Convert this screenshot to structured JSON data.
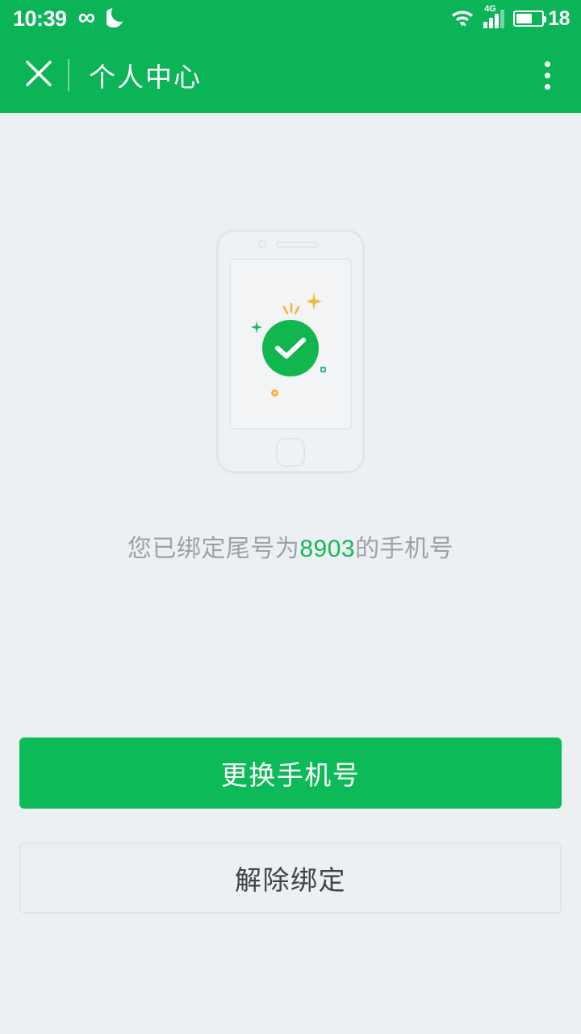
{
  "status_bar": {
    "time": "10:39",
    "infinity_icon": "infinity-icon",
    "moon_icon": "moon-icon",
    "wifi_icon": "wifi-icon",
    "network_type": "4G",
    "signal_icon": "signal-icon",
    "battery_icon": "battery-icon",
    "battery_percent": "18"
  },
  "app_bar": {
    "close_icon": "close-icon",
    "title": "个人中心",
    "overflow_icon": "overflow-menu-icon"
  },
  "illustration": {
    "phone_icon": "phone-illustration",
    "check_icon": "success-check-icon",
    "sparkle_star": "sparkle-star-icon",
    "sparkle_plus": "sparkle-plus-icon",
    "sparkle_burst": "sparkle-burst-icon",
    "sparkle_square": "sparkle-square-icon",
    "sparkle_ring": "sparkle-ring-icon"
  },
  "content": {
    "bound_prefix": "您已绑定尾号为",
    "bound_digits": "8903",
    "bound_suffix": "的手机号"
  },
  "actions": {
    "change_phone_label": "更换手机号",
    "unbind_label": "解除绑定"
  },
  "colors": {
    "brand_green": "#0bb557",
    "button_green": "#0cba58",
    "check_green": "#11b64e",
    "digits_green": "#14b957",
    "background": "#edf0f2",
    "muted_text": "#9aa3a8",
    "secondary_text": "#3d4347",
    "outline": "#e2e6e9",
    "illustration_line": "#e1e5e8",
    "accent_yellow": "#f5b63c",
    "accent_teal": "#2fb9a4"
  }
}
